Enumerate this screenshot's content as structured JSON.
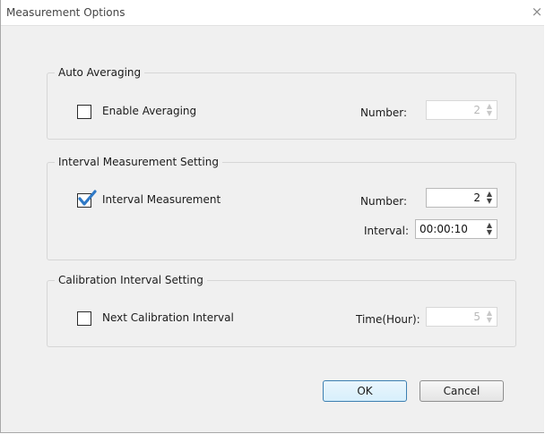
{
  "window": {
    "title": "Measurement Options",
    "close_glyph": "×"
  },
  "auto_averaging": {
    "legend": "Auto Averaging",
    "enable_label": "Enable Averaging",
    "enable_checked": false,
    "number_label": "Number:",
    "number_value": "2",
    "number_enabled": false
  },
  "interval_measurement": {
    "legend": "Interval Measurement Setting",
    "enable_label": "Interval Measurement",
    "enable_checked": true,
    "number_label": "Number:",
    "number_value": "2",
    "interval_label": "Interval:",
    "interval_value": "00:00:10"
  },
  "calibration_interval": {
    "legend": "Calibration Interval Setting",
    "enable_label": "Next Calibration Interval",
    "enable_checked": false,
    "time_label": "Time(Hour):",
    "time_value": "5",
    "time_enabled": false
  },
  "buttons": {
    "ok": "OK",
    "cancel": "Cancel"
  },
  "colors": {
    "check_mark": "#2f79c6",
    "default_button_border": "#3c7fb1"
  }
}
